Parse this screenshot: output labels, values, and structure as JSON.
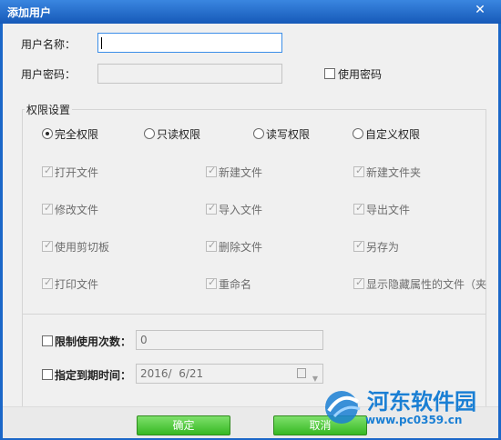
{
  "window": {
    "title": "添加用户",
    "close_glyph": "✕"
  },
  "form": {
    "username_label": "用户名称：",
    "username_value": "",
    "password_label": "用户密码：",
    "password_value": "",
    "use_password_label": "使用密码"
  },
  "permissions": {
    "group_title": "权限设置",
    "modes": [
      {
        "label": "完全权限",
        "selected": true
      },
      {
        "label": "只读权限",
        "selected": false
      },
      {
        "label": "读写权限",
        "selected": false
      },
      {
        "label": "自定义权限",
        "selected": false
      }
    ],
    "items": [
      {
        "label": "打开文件",
        "checked": true
      },
      {
        "label": "新建文件",
        "checked": true
      },
      {
        "label": "新建文件夹",
        "checked": true
      },
      {
        "label": "修改文件",
        "checked": true
      },
      {
        "label": "导入文件",
        "checked": true
      },
      {
        "label": "导出文件",
        "checked": true
      },
      {
        "label": "使用剪切板",
        "checked": true
      },
      {
        "label": "删除文件",
        "checked": true
      },
      {
        "label": "另存为",
        "checked": true
      },
      {
        "label": "打印文件",
        "checked": true
      },
      {
        "label": "重命名",
        "checked": true
      },
      {
        "label": "显示隐藏属性的文件（夹",
        "checked": true
      }
    ]
  },
  "limits": {
    "usage_label": "限制使用次数：",
    "usage_value": "0",
    "expiry_label": "指定到期时间：",
    "expiry_value": "2016/  6/21"
  },
  "buttons": {
    "ok": "确定",
    "cancel": "取消"
  },
  "watermark": {
    "text": "河东软件园",
    "url": "www.pc0359.cn"
  },
  "colors": {
    "title_bar": "#1659b8",
    "button_green": "#36b823",
    "watermark_blue": "#1a7fd4"
  }
}
